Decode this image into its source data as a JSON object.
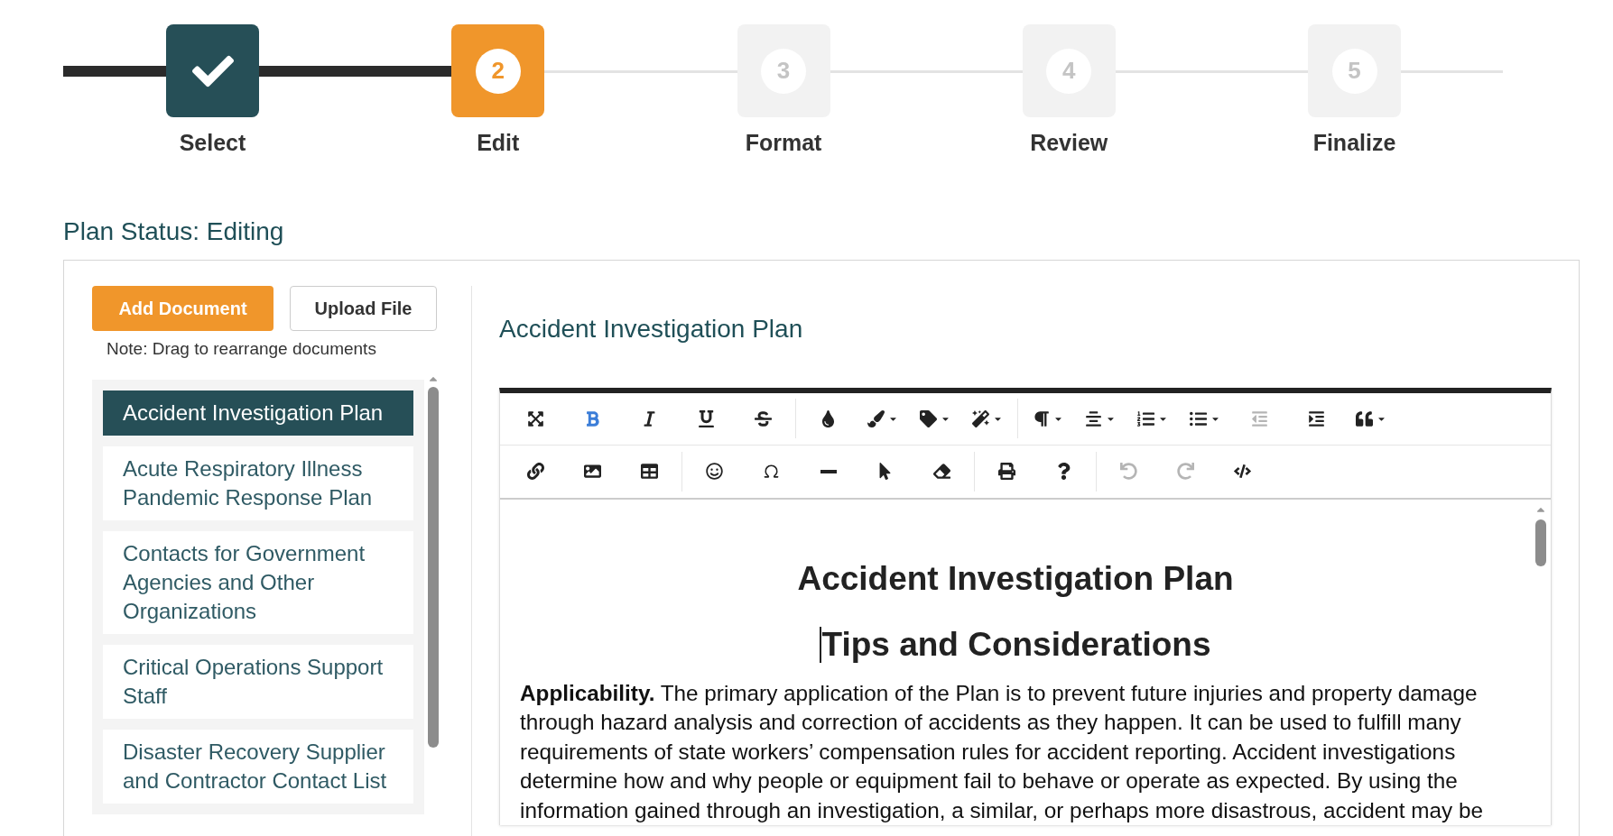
{
  "steps": [
    {
      "label": "Select",
      "done": true,
      "selected": false
    },
    {
      "number": "2",
      "label": "Edit",
      "done": false,
      "selected": true
    },
    {
      "number": "3",
      "label": "Format",
      "done": false,
      "selected": false
    },
    {
      "number": "4",
      "label": "Review",
      "done": false,
      "selected": false
    },
    {
      "number": "5",
      "label": "Finalize",
      "done": false,
      "selected": false
    }
  ],
  "plan_status": "Plan Status: Editing",
  "buttons": {
    "add": "Add Document",
    "upload": "Upload File"
  },
  "note": "Note: Drag to rearrange documents",
  "documents": [
    {
      "title": "Accident Investigation Plan",
      "selected": true
    },
    {
      "title": "Acute Respiratory Illness Pandemic Response Plan",
      "selected": false
    },
    {
      "title": "Contacts for Government Agencies and Other Organizations",
      "selected": false
    },
    {
      "title": "Critical Operations Support Staff",
      "selected": false
    },
    {
      "title": "Disaster Recovery Supplier and Contractor Contact List",
      "selected": false
    }
  ],
  "editor": {
    "title": "Accident Investigation Plan",
    "toolbar": [
      [
        {
          "active": false,
          "disabled": false
        },
        {
          "active": true,
          "disabled": false
        },
        {
          "active": false,
          "disabled": false
        },
        {
          "active": false,
          "disabled": false
        },
        {
          "active": false,
          "disabled": false
        },
        {
          "active": false,
          "disabled": false
        },
        {
          "active": false,
          "disabled": false
        },
        {
          "active": false,
          "disabled": false
        },
        {
          "active": false,
          "disabled": false
        },
        {
          "active": false,
          "disabled": false
        },
        {
          "active": false,
          "disabled": false
        },
        {
          "active": false,
          "disabled": false
        },
        {
          "active": false,
          "disabled": false
        },
        {
          "active": false,
          "disabled": true
        },
        {
          "active": false,
          "disabled": false
        },
        {
          "active": false,
          "disabled": false
        }
      ],
      [
        {
          "active": false,
          "disabled": false
        },
        {
          "active": false,
          "disabled": false
        },
        {
          "active": false,
          "disabled": false
        },
        {
          "active": false,
          "disabled": false
        },
        {
          "active": false,
          "disabled": false
        },
        {
          "active": false,
          "disabled": false
        },
        {
          "active": false,
          "disabled": false
        },
        {
          "active": false,
          "disabled": false
        },
        {
          "active": false,
          "disabled": false
        },
        {
          "active": false,
          "disabled": false
        },
        {
          "active": false,
          "disabled": true
        },
        {
          "active": false,
          "disabled": true
        },
        {
          "active": false,
          "disabled": false
        }
      ]
    ],
    "heading": "Accident Investigation Plan",
    "subheading": "Tips and Considerations",
    "paragraph": "**Applicability.** The primary application of the Plan is to prevent future injuries and property damage through hazard analysis and correction of accidents as they happen. It can be used to fulfill many requirements of state workers’ compensation rules for accident reporting. Accident investigations determine how and why people or equipment fail to behave or operate as expected. By using the information gained through an investigation, a similar, or perhaps more disastrous, accident may be"
  }
}
